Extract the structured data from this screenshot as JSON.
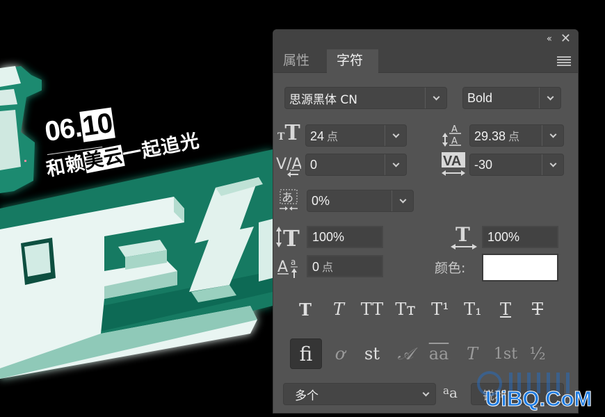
{
  "canvas": {
    "date_prefix": "06.",
    "date_selected": "10",
    "slogan_prefix": "和赖",
    "slogan_selected": "美云",
    "slogan_suffix": "一起追光"
  },
  "panel": {
    "collapse_label": "‹‹",
    "close_label": "✕",
    "tabs": [
      {
        "label": "属性",
        "active": false
      },
      {
        "label": "字符",
        "active": true
      }
    ],
    "font_family": "思源黑体 CN",
    "font_style": "Bold",
    "font_size": {
      "value": "24",
      "unit": "点"
    },
    "leading": {
      "value": "29.38",
      "unit": "点"
    },
    "kerning": {
      "value": "0"
    },
    "tracking": {
      "value": "-30"
    },
    "tsume": {
      "value": "0%"
    },
    "vertical_scale": {
      "value": "100%"
    },
    "horizontal_scale": {
      "value": "100%"
    },
    "baseline_shift": {
      "value": "0",
      "unit": "点"
    },
    "color_label": "颜色:",
    "color_value": "#ffffff",
    "style_buttons": [
      {
        "name": "faux-bold",
        "glyph": "T"
      },
      {
        "name": "faux-italic",
        "glyph": "T"
      },
      {
        "name": "all-caps",
        "glyph": "TT"
      },
      {
        "name": "small-caps",
        "glyph": "Tт"
      },
      {
        "name": "superscript",
        "glyph": "T¹"
      },
      {
        "name": "subscript",
        "glyph": "T₁"
      },
      {
        "name": "underline",
        "glyph": "T"
      },
      {
        "name": "strikethrough",
        "glyph": "T"
      }
    ],
    "opentype_buttons": [
      {
        "name": "standard-ligatures",
        "glyph": "fi",
        "pressed": true,
        "dim": false
      },
      {
        "name": "contextual-alternates",
        "glyph": "ơ",
        "pressed": false,
        "dim": true
      },
      {
        "name": "discretionary-ligatures",
        "glyph": "st",
        "pressed": false,
        "dim": false
      },
      {
        "name": "swash",
        "glyph": "𝒜",
        "pressed": false,
        "dim": true
      },
      {
        "name": "stylistic-alternates",
        "glyph": "aa",
        "pressed": false,
        "dim": true
      },
      {
        "name": "titling-alternates",
        "glyph": "T",
        "pressed": false,
        "dim": true
      },
      {
        "name": "ordinals",
        "glyph": "1st",
        "pressed": false,
        "dim": true
      },
      {
        "name": "fractions",
        "glyph": "½",
        "pressed": false,
        "dim": true
      }
    ],
    "language": "多个",
    "antialias_icon": "aa",
    "antialias": "锐利"
  },
  "watermark": "UiBQ.CoM"
}
